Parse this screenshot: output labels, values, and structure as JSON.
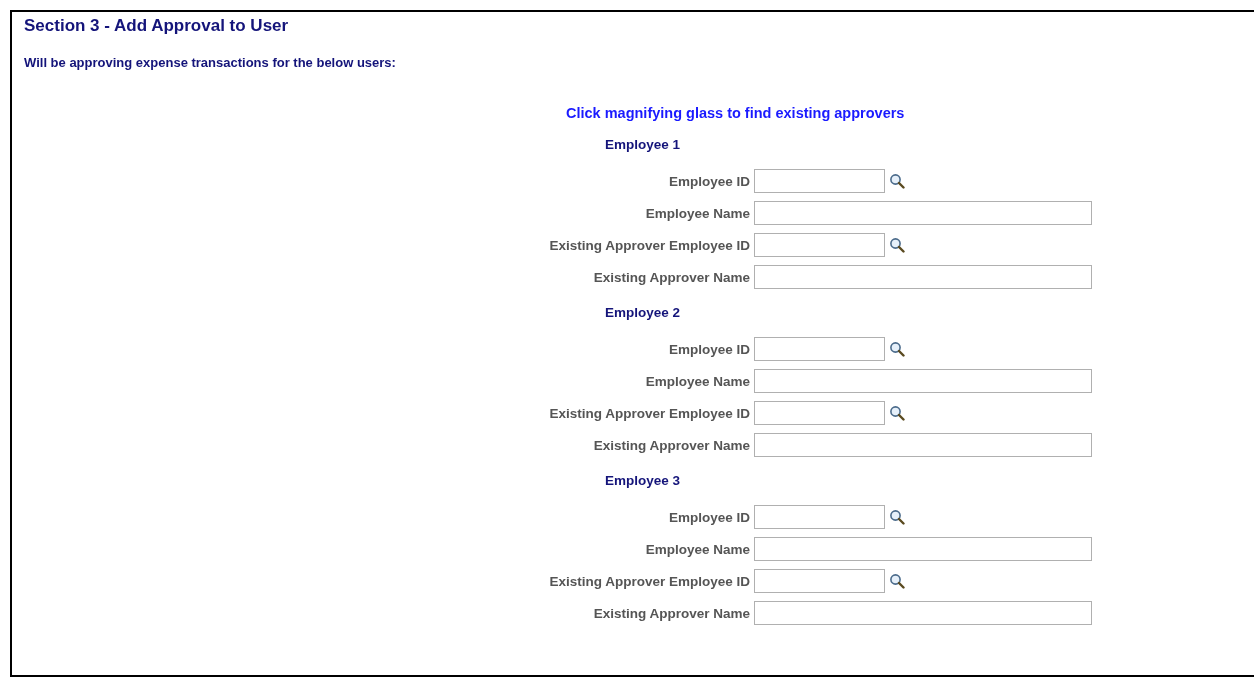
{
  "section": {
    "title": "Section 3 - Add Approval to User",
    "intro": "Will be approving expense transactions for the below users:",
    "instruction": "Click magnifying glass to find existing approvers",
    "employees": [
      {
        "heading": "Employee 1",
        "fields": [
          {
            "label": "Employee ID",
            "kind": "lookup"
          },
          {
            "label": "Employee Name",
            "kind": "text"
          },
          {
            "label": "Existing Approver Employee ID",
            "kind": "lookup"
          },
          {
            "label": "Existing Approver Name",
            "kind": "text"
          }
        ]
      },
      {
        "heading": "Employee 2",
        "fields": [
          {
            "label": "Employee ID",
            "kind": "lookup"
          },
          {
            "label": "Employee Name",
            "kind": "text"
          },
          {
            "label": "Existing Approver Employee ID",
            "kind": "lookup"
          },
          {
            "label": "Existing Approver Name",
            "kind": "text"
          }
        ]
      },
      {
        "heading": "Employee 3",
        "fields": [
          {
            "label": "Employee ID",
            "kind": "lookup"
          },
          {
            "label": "Employee Name",
            "kind": "text"
          },
          {
            "label": "Existing Approver Employee ID",
            "kind": "lookup"
          },
          {
            "label": "Existing Approver Name",
            "kind": "text"
          }
        ]
      }
    ]
  }
}
